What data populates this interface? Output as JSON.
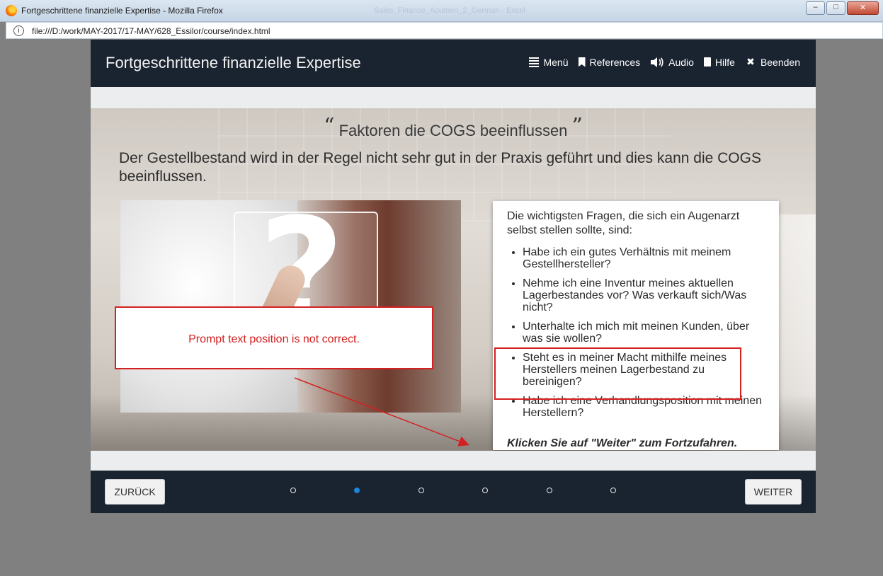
{
  "window": {
    "title": "Fortgeschrittene finanzielle Expertise - Mozilla Firefox",
    "ghost_title": "Sales_Finance_Acumen_2_German - Excel",
    "url": "file:///D:/work/MAY-2017/17-MAY/628_Essilor/course/index.html",
    "controls": {
      "minimize": "–",
      "maximize": "□",
      "close": "✕"
    }
  },
  "course": {
    "title": "Fortgeschrittene finanzielle Expertise",
    "nav": [
      {
        "label": "Menü",
        "icon": "menu-icon"
      },
      {
        "label": "References",
        "icon": "bookmark-icon"
      },
      {
        "label": "Audio",
        "icon": "speaker-icon"
      },
      {
        "label": "Hilfe",
        "icon": "help-icon"
      },
      {
        "label": "Beenden",
        "icon": "close-icon"
      }
    ]
  },
  "slide": {
    "heading": "Faktoren die COGS beeinflussen",
    "quote_open": "“",
    "quote_close": "”",
    "subheading": "Der Gestellbestand wird in der Regel nicht sehr gut in der Praxis geführt und dies kann die COGS beeinflussen.",
    "question_mark": "?",
    "info": {
      "intro": "Die wichtigsten Fragen, die sich ein Augenarzt selbst stellen sollte, sind:",
      "questions": [
        "Habe ich ein gutes Verhältnis mit meinem Gestellhersteller?",
        "Nehme ich eine Inventur meines aktuellen Lagerbestandes vor? Was verkauft sich/Was nicht?",
        "Unterhalte ich mich mit meinen Kunden, über was sie wollen?",
        "Steht es in meiner Macht mithilfe meines Herstellers meinen Lagerbestand zu bereinigen?",
        "Habe ich eine Verhandlungsposition mit meinen Herstellern?"
      ],
      "cta": "Klicken Sie auf \"Weiter\" zum Fortzufahren."
    }
  },
  "annotation": {
    "text": "Prompt text position is not correct.",
    "color": "#d42020"
  },
  "footer": {
    "back_label": "ZURÜCK",
    "next_label": "WEITER",
    "pages": 6,
    "current_page": 2
  },
  "colors": {
    "header_bg": "#1a2330",
    "accent_dot": "#1a86d6",
    "strip": "#ecedef"
  }
}
